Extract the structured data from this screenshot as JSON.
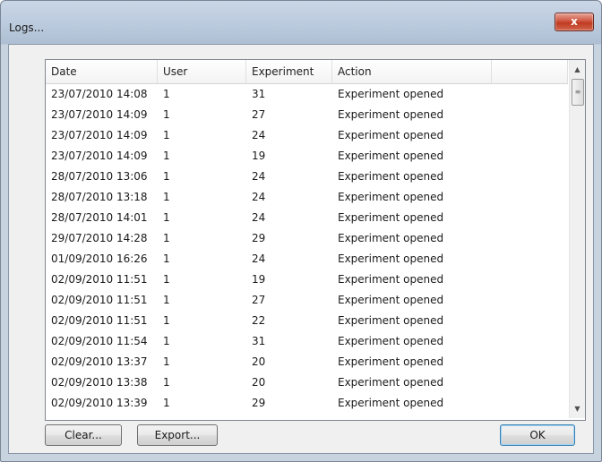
{
  "window": {
    "title": "Logs...",
    "close_symbol": "x"
  },
  "table": {
    "columns": [
      "Date",
      "User",
      "Experiment",
      "Action",
      ""
    ],
    "rows": [
      [
        "23/07/2010 14:08",
        "1",
        "31",
        "Experiment opened"
      ],
      [
        "23/07/2010 14:09",
        "1",
        "27",
        "Experiment opened"
      ],
      [
        "23/07/2010 14:09",
        "1",
        "24",
        "Experiment opened"
      ],
      [
        "23/07/2010 14:09",
        "1",
        "19",
        "Experiment opened"
      ],
      [
        "28/07/2010 13:06",
        "1",
        "24",
        "Experiment opened"
      ],
      [
        "28/07/2010 13:18",
        "1",
        "24",
        "Experiment opened"
      ],
      [
        "28/07/2010 14:01",
        "1",
        "24",
        "Experiment opened"
      ],
      [
        "29/07/2010 14:28",
        "1",
        "29",
        "Experiment opened"
      ],
      [
        "01/09/2010 16:26",
        "1",
        "24",
        "Experiment opened"
      ],
      [
        "02/09/2010 11:51",
        "1",
        "19",
        "Experiment opened"
      ],
      [
        "02/09/2010 11:51",
        "1",
        "27",
        "Experiment opened"
      ],
      [
        "02/09/2010 11:51",
        "1",
        "22",
        "Experiment opened"
      ],
      [
        "02/09/2010 11:54",
        "1",
        "31",
        "Experiment opened"
      ],
      [
        "02/09/2010 13:37",
        "1",
        "20",
        "Experiment opened"
      ],
      [
        "02/09/2010 13:38",
        "1",
        "20",
        "Experiment opened"
      ],
      [
        "02/09/2010 13:39",
        "1",
        "29",
        "Experiment opened"
      ]
    ]
  },
  "scrollbar": {
    "up_symbol": "▲",
    "down_symbol": "▼",
    "grip_symbol": "≡"
  },
  "buttons": {
    "clear": "Clear...",
    "export": "Export...",
    "ok": "OK"
  }
}
